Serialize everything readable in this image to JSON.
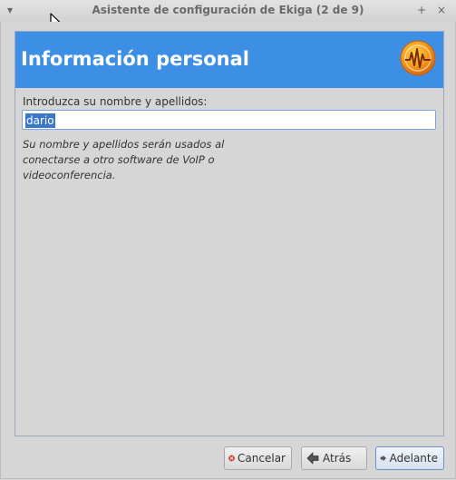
{
  "window": {
    "title": "Asistente de configuración de Ekiga (2 de 9)",
    "menu_icon": "chevron-down-icon",
    "maximize_icon": "plus-icon",
    "close_icon": "close-icon"
  },
  "page": {
    "title": "Información personal",
    "logo_icon": "ekiga-logo-icon",
    "prompt": "Introduzca su nombre y apellidos:",
    "name_value": "dario",
    "hint": "Su nombre y apellidos serán usados al conectarse a otro software de VoIP o videoconferencia."
  },
  "buttons": {
    "cancel": "Cancelar",
    "back": "Atrás",
    "next": "Adelante"
  },
  "colors": {
    "header_bg": "#3c8fe4",
    "selection": "#3b78c9"
  }
}
